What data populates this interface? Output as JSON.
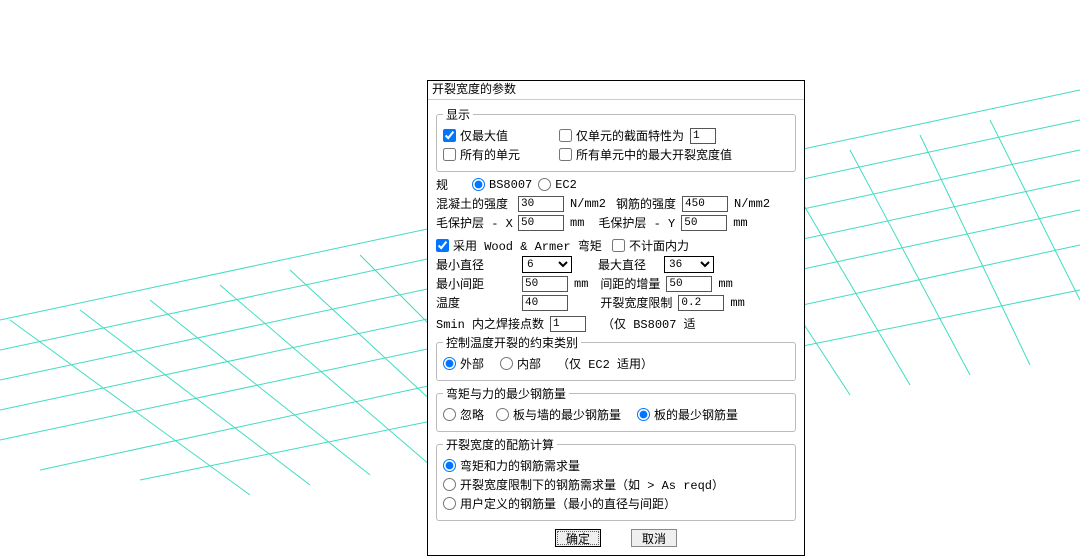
{
  "dialog": {
    "title": "开裂宽度的参数"
  },
  "display": {
    "legend": "显示",
    "only_max": "仅最大值",
    "only_unit_prop": "仅单元的截面特性为",
    "only_unit_prop_val": "1",
    "all_units": "所有的单元",
    "max_crack_all": "所有单元中的最大开裂宽度值"
  },
  "code": {
    "label": "规",
    "bs8007": "BS8007",
    "ec2": "EC2"
  },
  "strength": {
    "concrete": "混凝土的强度",
    "concrete_val": "30",
    "concrete_unit": "N/mm2",
    "rebar": "钢筋的强度",
    "rebar_val": "450",
    "rebar_unit": "N/mm2"
  },
  "cover": {
    "x_label": "毛保护层 - X",
    "x_val": "50",
    "x_unit": "mm",
    "y_label": "毛保护层 - Y",
    "y_val": "50",
    "y_unit": "mm"
  },
  "options": {
    "wood_armer": "采用 Wood & Armer 弯矩",
    "no_inplane": "不计面内力"
  },
  "dims": {
    "min_dia": "最小直径",
    "min_dia_val": "6",
    "max_dia": "最大直径",
    "max_dia_val": "36",
    "min_spacing": "最小间距",
    "min_spacing_val": "50",
    "spacing_inc": "间距的增量",
    "spacing_inc_val": "50",
    "mm": "mm",
    "temperature": "温度",
    "temperature_val": "40",
    "crack_limit": "开裂宽度限制",
    "crack_limit_val": "0.2"
  },
  "smin": {
    "label": "Smin 内之焊接点数",
    "val": "1",
    "note": "（仅 BS8007 适"
  },
  "restraint": {
    "legend": "控制温度开裂的约束类别",
    "external": "外部",
    "internal": "内部",
    "note": "（仅 EC2 适用）"
  },
  "minsteel": {
    "legend": "弯矩与力的最少钢筋量",
    "ignore": "忽略",
    "slab_wall": "板与墙的最少钢筋量",
    "slab": "板的最少钢筋量"
  },
  "calc": {
    "legend": "开裂宽度的配筋计算",
    "opt1": "弯矩和力的钢筋需求量",
    "opt2": "开裂宽度限制下的钢筋需求量（如 > As reqd）",
    "opt3": "用户定义的钢筋量（最小的直径与间距）"
  },
  "buttons": {
    "ok": "确定",
    "cancel": "取消"
  }
}
